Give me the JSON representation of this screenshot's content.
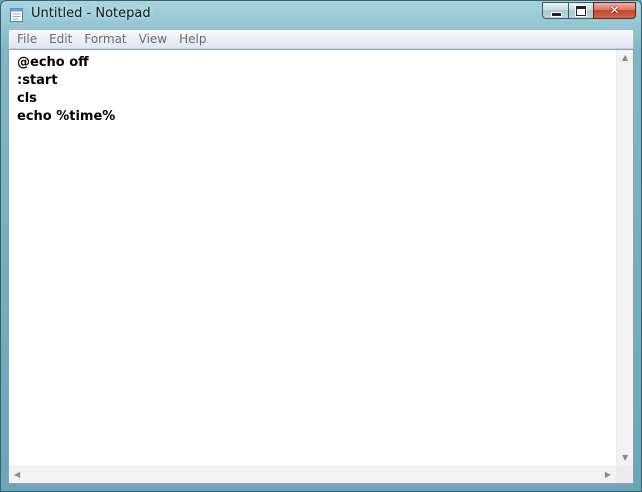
{
  "window": {
    "title": "Untitled - Notepad",
    "app_icon": "notepad-icon"
  },
  "caption_buttons": {
    "minimize_icon": "minimize-icon",
    "maximize_icon": "maximize-icon",
    "close_icon": "close-icon",
    "close_glyph": "✕"
  },
  "menu": {
    "items": [
      "File",
      "Edit",
      "Format",
      "View",
      "Help"
    ]
  },
  "editor": {
    "lines": [
      "@echo off",
      ":start",
      "cls",
      "echo %time%"
    ]
  },
  "scrollbars": {
    "up_glyph": "▲",
    "down_glyph": "▼",
    "left_glyph": "◀",
    "right_glyph": "▶"
  },
  "colors": {
    "frame": "#6aa6b8",
    "close_button": "#c3462d",
    "menu_text": "#6b6b6b"
  }
}
